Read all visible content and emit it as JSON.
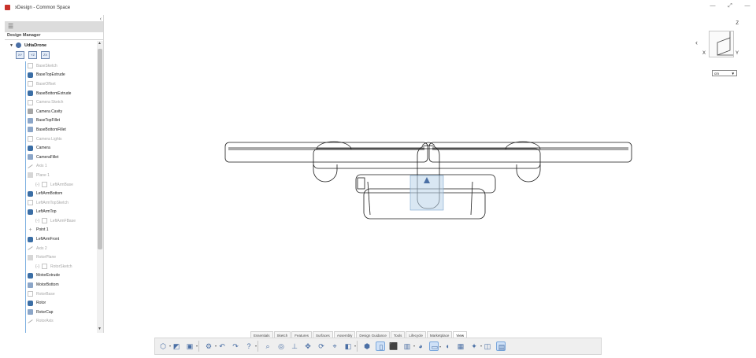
{
  "window": {
    "title": "xDesign - Common Space",
    "controls": [
      "—",
      "⤢",
      "—"
    ]
  },
  "sidebar": {
    "collapse_icon": "chevron-left-icon",
    "collapse_glyph": "‹",
    "tree_toggle_icon": "tree-icon",
    "heading": "Design Manager",
    "root": {
      "label": "UdtaDrone",
      "expanded": true
    },
    "planes": [
      "XY",
      "YZ",
      "ZX"
    ],
    "items": [
      {
        "label": "BaseSketch",
        "type": "sketch",
        "dim": true
      },
      {
        "label": "BaseTopExtrude",
        "type": "extrude",
        "dim": false
      },
      {
        "label": "BaseOffset",
        "type": "sketch",
        "dim": true
      },
      {
        "label": "BaseBottomExtrude",
        "type": "extrude",
        "dim": false
      },
      {
        "label": "Camera Sketch",
        "type": "sketch",
        "dim": true
      },
      {
        "label": "Camera Cavity",
        "type": "cavity",
        "dim": false
      },
      {
        "label": "BaseTopFillet",
        "type": "fillet",
        "dim": false
      },
      {
        "label": "BaseBottomFillet",
        "type": "fillet",
        "dim": false
      },
      {
        "label": "Camera Lights",
        "type": "sketch",
        "dim": true
      },
      {
        "label": "Camera",
        "type": "extrude",
        "dim": false
      },
      {
        "label": "CameraFillet",
        "type": "fillet",
        "dim": false
      },
      {
        "label": "Axis 1",
        "type": "axis",
        "dim": true
      },
      {
        "label": "Plane 1",
        "type": "plane",
        "dim": true
      },
      {
        "label": "LeftArmBase",
        "type": "sketch",
        "dim": true,
        "indent": true
      },
      {
        "label": "LeftArmBottom",
        "type": "extrude",
        "dim": false
      },
      {
        "label": "LeftArmTopSketch",
        "type": "sketch",
        "dim": true
      },
      {
        "label": "LeftArmTop",
        "type": "extrude",
        "dim": false
      },
      {
        "label": "LeftArmFBase",
        "type": "sketch",
        "dim": true,
        "indent": true
      },
      {
        "label": "Point 1",
        "type": "point",
        "dim": false
      },
      {
        "label": "LeftArmFront",
        "type": "extrude",
        "dim": false
      },
      {
        "label": "Axis 2",
        "type": "axis",
        "dim": true
      },
      {
        "label": "RotorPlane",
        "type": "plane",
        "dim": true
      },
      {
        "label": "RotorSketch",
        "type": "sketch",
        "dim": true,
        "indent": true
      },
      {
        "label": "MotorExtrude",
        "type": "extrude",
        "dim": false
      },
      {
        "label": "MotorBottom",
        "type": "fillet",
        "dim": false
      },
      {
        "label": "RotorBase",
        "type": "sketch",
        "dim": true
      },
      {
        "label": "Rotor",
        "type": "extrude",
        "dim": false
      },
      {
        "label": "RotorCap",
        "type": "fillet",
        "dim": false
      },
      {
        "label": "RotorAxis",
        "type": "axis",
        "dim": true
      }
    ]
  },
  "viewport": {
    "view_cube": {
      "x": "X",
      "y": "Y",
      "z": "Z",
      "chevron": "‹"
    },
    "unit": "cm",
    "unit_dropdown_glyph": "▼"
  },
  "ribbon": {
    "tabs": [
      "Essentials",
      "Sketch",
      "Features",
      "Surfaces",
      "Assembly",
      "Design Guidance",
      "Tools",
      "Lifecycle",
      "Marketplace",
      "View"
    ],
    "active_tab": "View",
    "tools": [
      {
        "name": "view-orientation-icon",
        "glyph": "⬡",
        "dropdown": true
      },
      {
        "name": "standard-views-icon",
        "glyph": "◩",
        "dropdown": false
      },
      {
        "name": "display-style-icon",
        "glyph": "▣",
        "dropdown": true
      },
      {
        "name": "render-settings-icon",
        "glyph": "⚙",
        "dropdown": true
      },
      {
        "name": "undo-icon",
        "glyph": "↶",
        "dropdown": false
      },
      {
        "name": "redo-icon",
        "glyph": "↷",
        "dropdown": false
      },
      {
        "name": "help-icon",
        "glyph": "?",
        "dropdown": true
      },
      {
        "name": "zoom-icon",
        "glyph": "⌕",
        "dropdown": false
      },
      {
        "name": "zoom-fit-icon",
        "glyph": "◎",
        "dropdown": false
      },
      {
        "name": "normal-to-icon",
        "glyph": "⊥",
        "dropdown": false
      },
      {
        "name": "pan-icon",
        "glyph": "✥",
        "dropdown": false
      },
      {
        "name": "rotate-icon",
        "glyph": "⟳",
        "dropdown": false
      },
      {
        "name": "zoom-selection-icon",
        "glyph": "⌖",
        "dropdown": false
      },
      {
        "name": "section-view-icon",
        "glyph": "◧",
        "dropdown": true
      },
      {
        "name": "shaded-icon",
        "glyph": "⬢",
        "dropdown": false
      },
      {
        "name": "wireframe-icon",
        "glyph": "▯",
        "dropdown": false
      },
      {
        "name": "shaded-edges-icon",
        "glyph": "⬛",
        "dropdown": false
      },
      {
        "name": "transparency-icon",
        "glyph": "▥",
        "dropdown": true
      },
      {
        "name": "appearance-icon",
        "glyph": "◕",
        "dropdown": false
      },
      {
        "name": "scene-icon",
        "glyph": "▭",
        "dropdown": true
      },
      {
        "name": "display-icon",
        "glyph": "◖",
        "dropdown": false
      },
      {
        "name": "grid-icon",
        "glyph": "▦",
        "dropdown": false
      },
      {
        "name": "lighting-icon",
        "glyph": "✦",
        "dropdown": true
      },
      {
        "name": "camera-icon",
        "glyph": "◫",
        "dropdown": false
      },
      {
        "name": "view-selector-icon",
        "glyph": "▤",
        "dropdown": false
      }
    ],
    "selected_tools": [
      "wireframe-icon",
      "scene-icon",
      "view-selector-icon"
    ]
  },
  "colors": {
    "selection": "#cfe1f7",
    "tree_line": "#7db0e0",
    "extrude_icon": "#3b6ea5",
    "logo": "#c8312a"
  }
}
